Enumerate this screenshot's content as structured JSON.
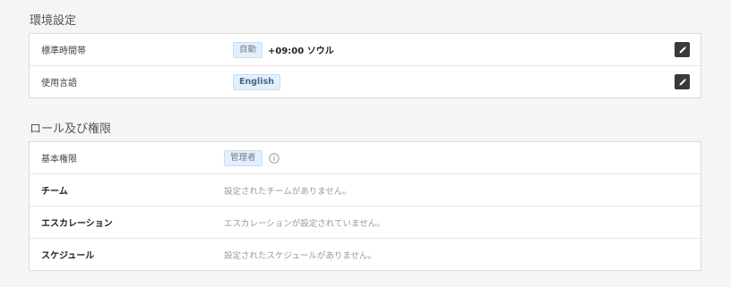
{
  "environment": {
    "title": "環境設定",
    "rows": [
      {
        "label": "標準時間帯",
        "badge": "自動",
        "value": "+09:00 ソウル"
      },
      {
        "label": "使用言語",
        "badge": "English"
      }
    ]
  },
  "roles": {
    "title": "ロール及び権限",
    "base_permission": {
      "label": "基本権限",
      "badge": "管理者"
    },
    "team": {
      "label": "チーム",
      "value": "設定されたチームがありません。"
    },
    "escalation": {
      "label": "エスカレーション",
      "value": "エスカレーションが設定されていません。"
    },
    "schedule": {
      "label": "スケジュール",
      "value": "設定されたスケジュールがありません。"
    }
  },
  "colors": {
    "accent_badge_bg": "#e3f0fb",
    "edit_button": "#3a3a3a"
  },
  "icons": {
    "edit": "pencil-icon",
    "info": "info-circle-icon"
  }
}
